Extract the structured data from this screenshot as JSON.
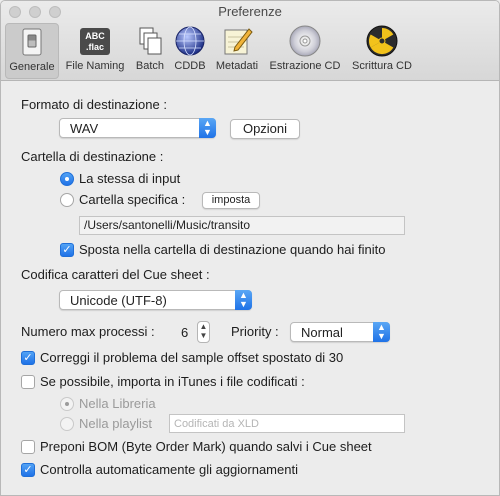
{
  "window": {
    "title": "Preferenze"
  },
  "toolbar": {
    "items": [
      {
        "label": "Generale",
        "icon": "switch-icon"
      },
      {
        "label": "File Naming",
        "icon": "abc-flac-icon"
      },
      {
        "label": "Batch",
        "icon": "documents-icon"
      },
      {
        "label": "CDDB",
        "icon": "globe-icon"
      },
      {
        "label": "Metadati",
        "icon": "notepad-pencil-icon"
      },
      {
        "label": "Estrazione CD",
        "icon": "cd-icon"
      },
      {
        "label": "Scrittura CD",
        "icon": "burn-icon"
      }
    ],
    "abc_text": "ABC",
    "flac_text": ".flac",
    "selected": "Generale"
  },
  "output": {
    "label": "Formato di destinazione :",
    "format_value": "WAV",
    "options_button": "Opzioni"
  },
  "destination": {
    "label": "Cartella di destinazione :",
    "radio_same": "La stessa di input",
    "radio_specific": "Cartella specifica :",
    "set_button": "imposta",
    "path": "/Users/santonelli/Music/transito",
    "move_checkbox": "Sposta nella cartella di destinazione quando hai finito"
  },
  "cue": {
    "label": "Codifica caratteri del Cue sheet :",
    "encoding_value": "Unicode (UTF-8)"
  },
  "process": {
    "label": "Numero max processi :",
    "value": "6",
    "priority_label": "Priority :",
    "priority_value": "Normal"
  },
  "options": {
    "fix_offset": "Correggi il problema del sample offset spostato di 30",
    "import_itunes": "Se possibile, importa in iTunes i file codificati :",
    "in_library": "Nella Libreria",
    "in_playlist": "Nella playlist",
    "playlist_placeholder": "Codificati da XLD",
    "bom": "Preponi BOM (Byte Order Mark) quando salvi i Cue sheet",
    "auto_update": "Controlla automaticamente gli aggiornamenti"
  },
  "colors": {
    "accent": "#1f72e7",
    "background": "#ececec"
  }
}
